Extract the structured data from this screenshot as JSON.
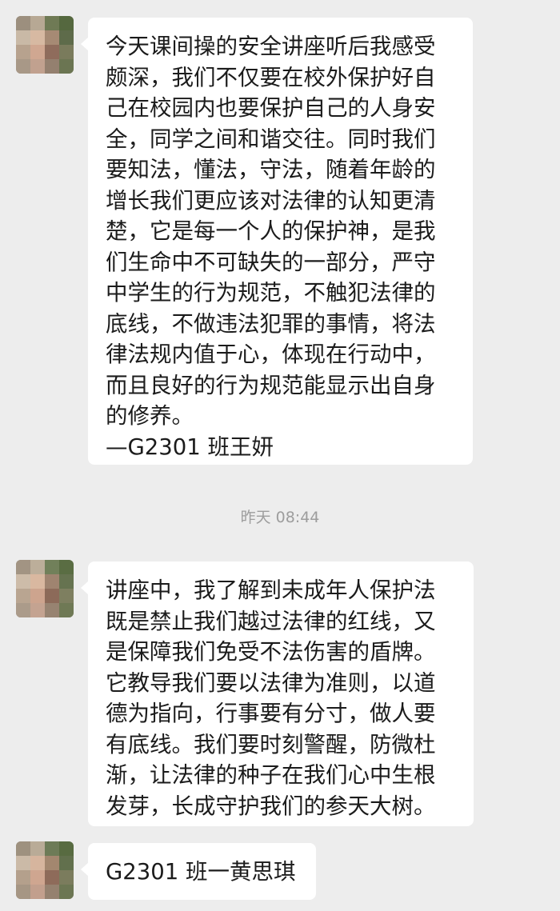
{
  "messages": [
    {
      "text": "今天课间操的安全讲座听后我感受\n颇深，我们不仅要在校外保护好自\n己在校园内也要保护自己的人身安\n全，同学之间和谐交往。同时我们\n要知法，懂法，守法，随着年龄的\n增长我们更应该对法律的认知更清\n楚，它是每一个人的保护神，是我\n们生命中不可缺失的一部分，严守\n中学生的行为规范，不触犯法律的\n底线，不做违法犯罪的事情，将法\n律法规内值于心，体现在行动中，\n而且良好的行为规范能显示出自身\n的修养。\n—G2301 班王妍"
    },
    {
      "text": "讲座中，我了解到未成年人保护法\n既是禁止我们越过法律的红线，又\n是保障我们免受不法伤害的盾牌。\n它教导我们要以法律为准则，以道\n德为指向，行事要有分寸，做人要\n有底线。我们要时刻警醒，防微杜\n渐，让法律的种子在我们心中生根\n发芽，长成守护我们的参天大树。"
    },
    {
      "text": "G2301 班一黄思琪"
    }
  ],
  "timestamp": "昨天 08:44",
  "colors": {
    "background": "#ededed",
    "bubble": "#ffffff",
    "text": "#1b1b1b",
    "timestamp": "#9d9d9d"
  }
}
